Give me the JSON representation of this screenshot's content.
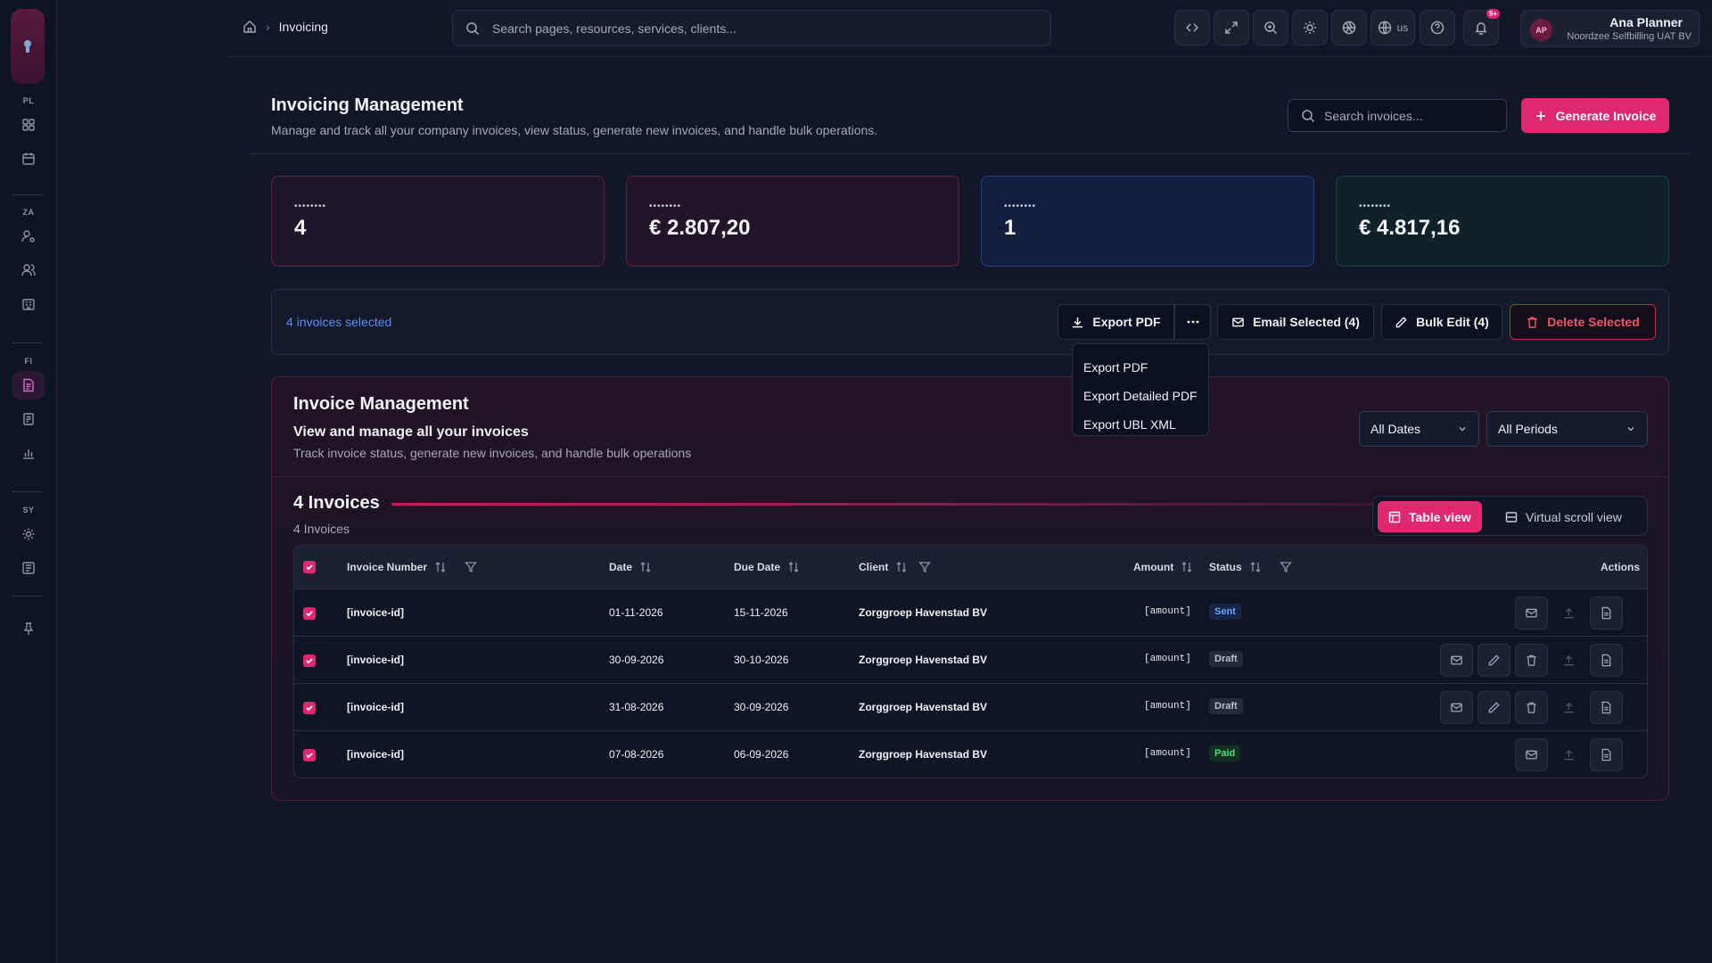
{
  "sidebar": {
    "groups": [
      {
        "label": "PL",
        "items": [
          {
            "icon": "grid-icon"
          },
          {
            "icon": "calendar-icon"
          }
        ]
      },
      {
        "label": "ZA",
        "items": [
          {
            "icon": "user-settings-icon"
          },
          {
            "icon": "users-icon"
          },
          {
            "icon": "building-icon"
          }
        ]
      },
      {
        "label": "FI",
        "items": [
          {
            "icon": "invoice-icon",
            "active": true
          },
          {
            "icon": "receipt-icon"
          },
          {
            "icon": "chart-icon"
          }
        ]
      },
      {
        "label": "SY",
        "items": [
          {
            "icon": "gear-icon"
          },
          {
            "icon": "printer-icon"
          }
        ]
      }
    ]
  },
  "header": {
    "breadcrumb": "Invoicing",
    "search_placeholder": "Search pages, resources, services, clients...",
    "language": "us",
    "notifications_badge": "9+",
    "user": {
      "initials": "AP",
      "name": "Ana Planner",
      "org": "Noordzee Selfbilling UAT BV"
    }
  },
  "page": {
    "title": "Invoicing Management",
    "subtitle": "Manage and track all your company invoices, view status, generate new invoices, and handle bulk operations.",
    "search_placeholder": "Search invoices...",
    "generate_label": "Generate Invoice"
  },
  "stats": [
    {
      "label": "••••••••",
      "value": "4"
    },
    {
      "label": "••••••••",
      "value": "€ 2.807,20"
    },
    {
      "label": "••••••••",
      "value": "1"
    },
    {
      "label": "••••••••",
      "value": "€ 4.817,16"
    }
  ],
  "bulk": {
    "selected_text": "4 invoices selected",
    "export_pdf": "Export PDF",
    "email_selected": "Email Selected (4)",
    "bulk_edit": "Bulk Edit (4)",
    "delete_selected": "Delete Selected",
    "menu": [
      "Export PDF",
      "Export Detailed PDF",
      "Export UBL XML"
    ]
  },
  "panel": {
    "title": "Invoice Management",
    "subtitle": "View and manage all your invoices",
    "description": "Track invoice status, generate new invoices, and handle bulk operations",
    "date_filter": "All Dates",
    "period_filter": "All Periods",
    "count_title": "4 Invoices",
    "count_sub": "4 Invoices",
    "view_table": "Table view",
    "view_virtual": "Virtual scroll view"
  },
  "table": {
    "headers": {
      "invoice_number": "Invoice Number",
      "date": "Date",
      "due_date": "Due Date",
      "client": "Client",
      "amount": "Amount",
      "status": "Status",
      "actions": "Actions"
    },
    "rows": [
      {
        "invoice": "[invoice-id]",
        "date": "01-11-2026",
        "due": "15-11-2026",
        "client": "Zorggroep Havenstad BV",
        "amount": "[amount]",
        "status": "Sent"
      },
      {
        "invoice": "[invoice-id]",
        "date": "30-09-2026",
        "due": "30-10-2026",
        "client": "Zorggroep Havenstad BV",
        "amount": "[amount]",
        "status": "Draft"
      },
      {
        "invoice": "[invoice-id]",
        "date": "31-08-2026",
        "due": "30-09-2026",
        "client": "Zorggroep Havenstad BV",
        "amount": "[amount]",
        "status": "Draft"
      },
      {
        "invoice": "[invoice-id]",
        "date": "07-08-2026",
        "due": "06-09-2026",
        "client": "Zorggroep Havenstad BV",
        "amount": "[amount]",
        "status": "Paid"
      }
    ]
  },
  "colors": {
    "accent": "#e0286f",
    "sent": "#6aa1ff",
    "paid": "#4ade80",
    "danger": "#f0566a"
  }
}
